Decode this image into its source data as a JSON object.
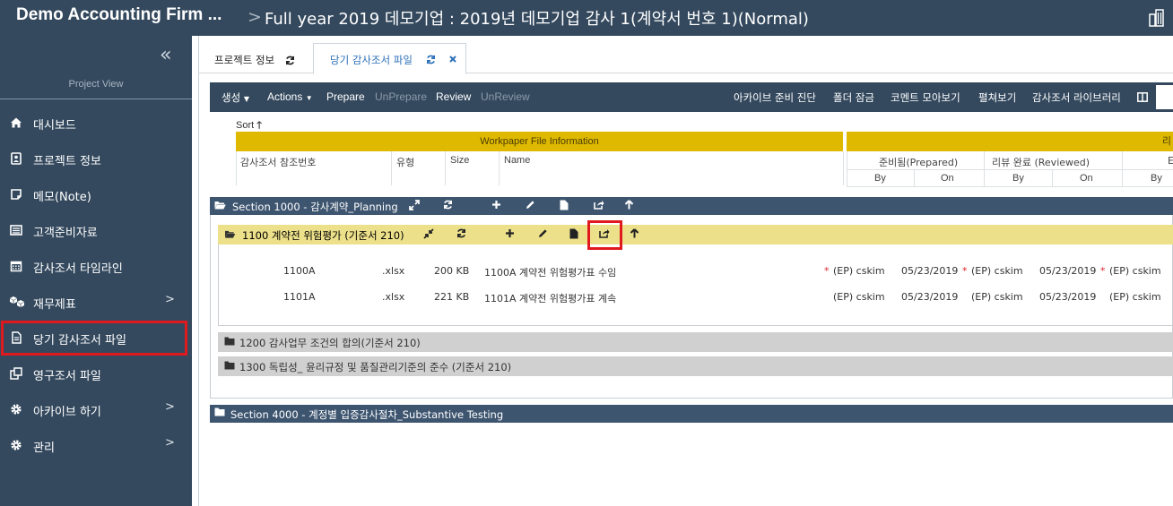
{
  "header": {
    "brand": "Demo Accounting Firm ...",
    "separator": ">",
    "project_title": "Full year 2019 데모기업 : 2019년 데모기업 감사 1(계약서 번호 1)(Normal)"
  },
  "sidebar": {
    "project_view_label": "Project View",
    "items": [
      {
        "label": "대시보드",
        "icon": "home-icon"
      },
      {
        "label": "프로젝트 정보",
        "icon": "contact-card-icon"
      },
      {
        "label": "메모(Note)",
        "icon": "note-icon"
      },
      {
        "label": "고객준비자료",
        "icon": "list-icon"
      },
      {
        "label": "감사조서 타임라인",
        "icon": "calendar-icon"
      },
      {
        "label": "재무제표",
        "icon": "cubes-icon",
        "chevron": ">"
      },
      {
        "label": "당기 감사조서 파일",
        "icon": "file-icon"
      },
      {
        "label": "영구조서 파일",
        "icon": "copy-icon"
      },
      {
        "label": "아카이브 하기",
        "icon": "gear-icon",
        "chevron": ">"
      },
      {
        "label": "관리",
        "icon": "gear-icon",
        "chevron": ">"
      }
    ]
  },
  "tabs": [
    {
      "label": "프로젝트 정보"
    },
    {
      "label": "당기 감사조서 파일"
    }
  ],
  "toolbar": {
    "create": "생성",
    "actions": "Actions",
    "prepare": "Prepare",
    "unprepare": "UnPrepare",
    "review": "Review",
    "unreview": "UnReview",
    "archive_diag": "아카이브 준비 진단",
    "folder_lock": "폴더 잠금",
    "comments": "코멘트 모아보기",
    "expand": "펼쳐보기",
    "library": "감사조서 라이브러리"
  },
  "table": {
    "sort_label": "Sort",
    "group_header": "Workpaper File Information",
    "group_header2": "리",
    "col_ref": "감사조서 참조번호",
    "col_type": "유형",
    "col_size": "Size",
    "col_name": "Name",
    "col_prepared": "준비됨(Prepared)",
    "col_reviewed": "리뷰 완료 (Reviewed)",
    "col_partial": "E",
    "sub_by": "By",
    "sub_on": "On",
    "sub_by3": "By"
  },
  "sections": {
    "s1000": "Section 1000 - 감사계약_Planning",
    "s4000": "Section 4000 - 계정별 입증감사절차_Substantive Testing"
  },
  "folders": {
    "f1100": "1100 계약전 위험평가 (기준서 210)",
    "f1200": "1200 감사업무 조건의 합의(기준서 210)",
    "f1300": "1300 독립성_ 윤리규정 및 품질관리기준의 준수 (기준서 210)"
  },
  "files": [
    {
      "ref": "1100A",
      "type": ".xlsx",
      "size": "200 KB",
      "name": "1100A 계약전 위험평가표 수임",
      "mark1": "*",
      "prep_by": "(EP) cskim",
      "prep_on": "05/23/2019",
      "mark2": "*",
      "rev_by": "(EP) cskim",
      "rev_on": "05/23/2019",
      "mark3": "*",
      "e_by": "(EP) cskim"
    },
    {
      "ref": "1101A",
      "type": ".xlsx",
      "size": "221 KB",
      "name": "1101A 계약전 위험평가표 계속",
      "mark1": "",
      "prep_by": "(EP) cskim",
      "prep_on": "05/23/2019",
      "mark2": "",
      "rev_by": "(EP) cskim",
      "rev_on": "05/23/2019",
      "mark3": "",
      "e_by": "(EP) cskim"
    }
  ],
  "colors": {
    "navy": "#34495e",
    "section": "#3e5570",
    "header_gold": "#dfb900",
    "folder_yellow": "#ece08a",
    "folder_gray": "#d0d0d0",
    "highlight_red": "#e0191f",
    "tab_blue": "#2c6fb8"
  }
}
